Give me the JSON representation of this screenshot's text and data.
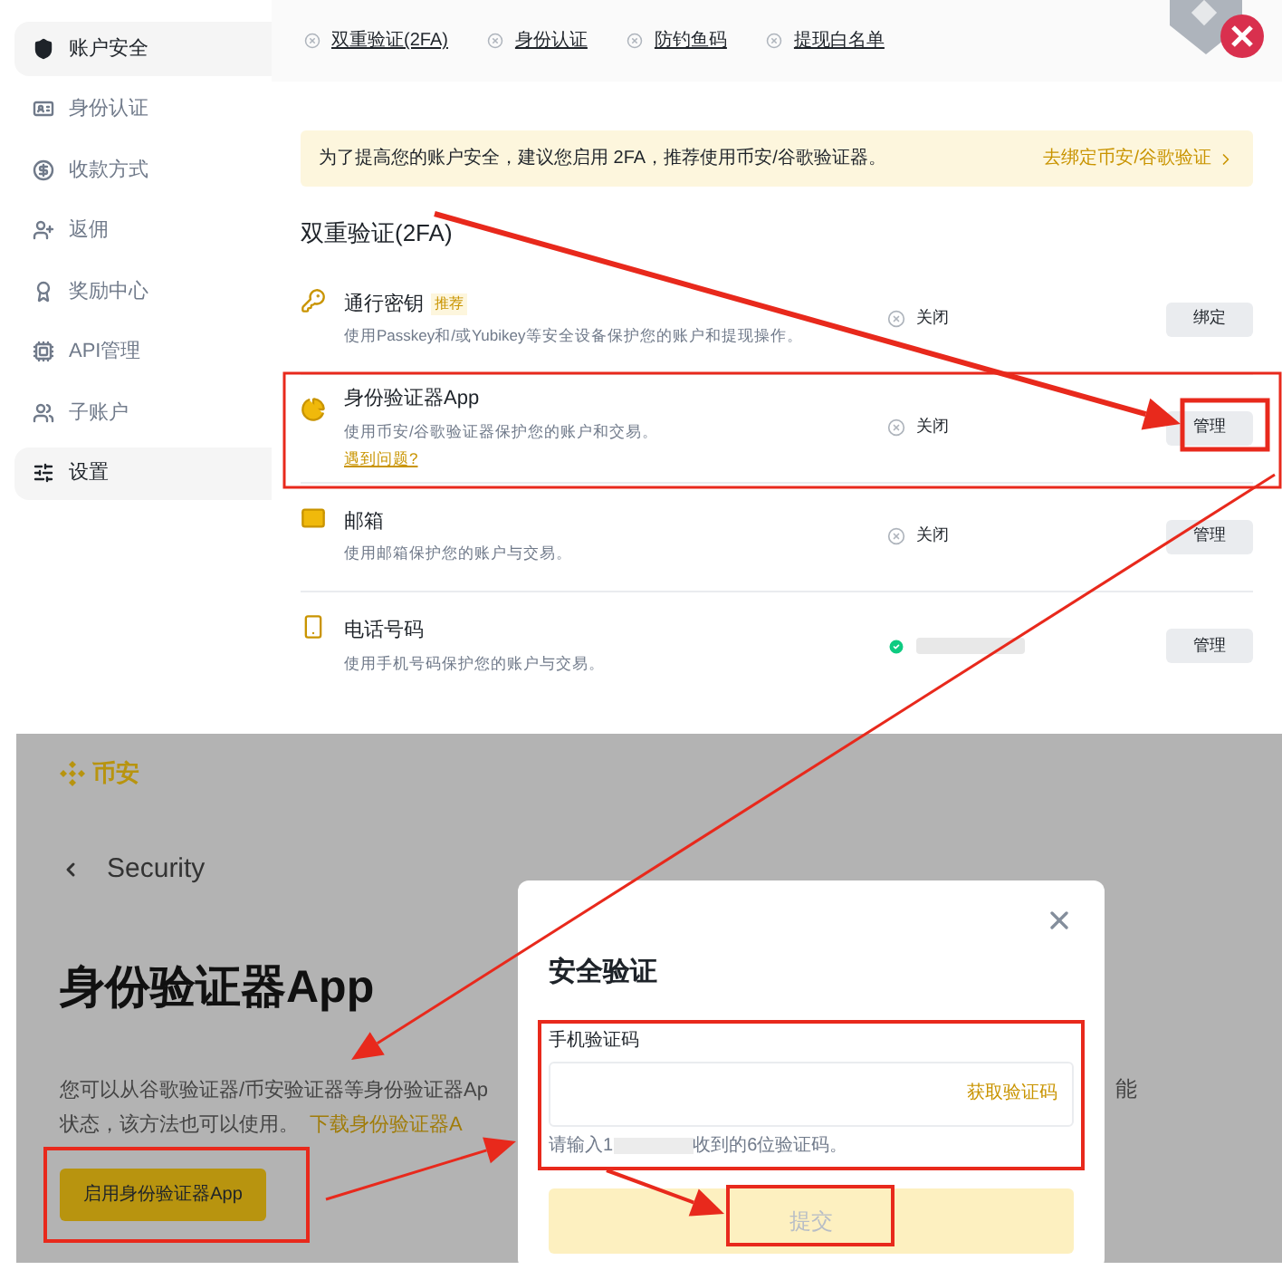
{
  "account_page": {
    "sidebar": {
      "items": [
        {
          "label": "账户安全",
          "selected": true
        },
        {
          "label": "身份认证",
          "selected": false
        },
        {
          "label": "收款方式",
          "selected": false
        },
        {
          "label": "返佣",
          "selected": false
        },
        {
          "label": "奖励中心",
          "selected": false
        },
        {
          "label": "API管理",
          "selected": false
        },
        {
          "label": "子账户",
          "selected": false
        },
        {
          "label": "设置",
          "selected": true
        }
      ]
    },
    "quick_links": [
      "双重验证(2FA)",
      "身份认证",
      "防钓鱼码",
      "提现白名单"
    ],
    "banner": {
      "text": "为了提高您的账户安全，建议您启用 2FA，推荐使用币安/谷歌验证器。",
      "link": "去绑定币安/谷歌验证"
    },
    "section_title": "双重验证(2FA)",
    "methods": [
      {
        "name": "通行密钥",
        "badge": "推荐",
        "description": "使用Passkey和/或Yubikey等安全设备保护您的账户和提现操作。",
        "enabled": false,
        "status": "关闭",
        "button": "绑定"
      },
      {
        "name": "身份验证器App",
        "description": "使用币安/谷歌验证器保护您的账户和交易。",
        "help_link": "遇到问题?",
        "enabled": false,
        "status": "关闭",
        "button": "管理"
      },
      {
        "name": "邮箱",
        "description": "使用邮箱保护您的账户与交易。",
        "enabled": false,
        "status": "关闭",
        "button": "管理"
      },
      {
        "name": "电话号码",
        "description": "使用手机号码保护您的账户与交易。",
        "enabled": true,
        "button": "管理"
      }
    ]
  },
  "authenticator_page": {
    "logo": "币安",
    "back_label": "Security",
    "title": "身份验证器App",
    "paragraph_line1": "您可以从谷歌验证器/币安验证器等身份验证器Ap",
    "paragraph_line1_end": "能",
    "paragraph_line2": "状态，该方法也可以使用。",
    "download_link": "下载身份验证器A",
    "enable_button": "启用身份验证器App",
    "dialog": {
      "title": "安全验证",
      "field_label": "手机验证码",
      "get_code": "获取验证码",
      "hint_start": "请输入1",
      "hint_end": "收到的6位验证码。",
      "submit": "提交"
    }
  }
}
